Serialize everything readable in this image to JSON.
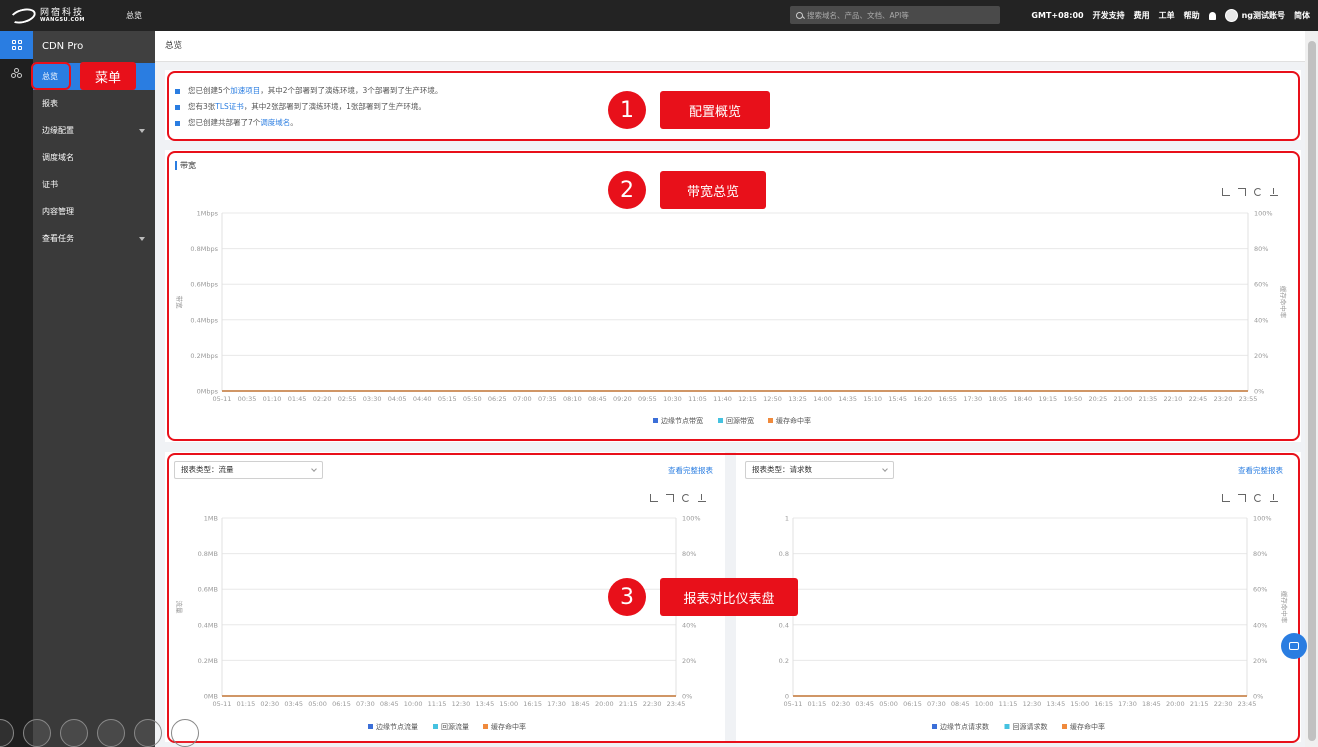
{
  "topbar": {
    "logo_cn": "网宿科技",
    "logo_en": "WANGSU.COM",
    "title": "总览",
    "search_placeholder": "搜索域名、产品、文档、API等",
    "timezone": "GMT+08:00",
    "links": [
      "开发支持",
      "费用",
      "工单",
      "帮助"
    ],
    "account": "ng测试账号",
    "lang": "简体"
  },
  "sidebar": {
    "product": "CDN Pro",
    "items": [
      {
        "label": "总览",
        "active": true,
        "caret": false
      },
      {
        "label": "报表",
        "active": false,
        "caret": false
      },
      {
        "label": "边缘配置",
        "active": false,
        "caret": true
      },
      {
        "label": "调度域名",
        "active": false,
        "caret": false
      },
      {
        "label": "证书",
        "active": false,
        "caret": false
      },
      {
        "label": "内容管理",
        "active": false,
        "caret": false
      },
      {
        "label": "查看任务",
        "active": false,
        "caret": true
      }
    ]
  },
  "main": {
    "breadcrumb": "总览",
    "overview": {
      "line1_pre": "您已创建5个",
      "line1_link": "加速项目",
      "line1_post": "，其中2个部署到了演练环境，3个部署到了生产环境。",
      "line2_pre": "您有3张",
      "line2_link": "TLS证书",
      "line2_post": "，其中2张部署到了演练环境，1张部署到了生产环境。",
      "line3_pre": "您已创建共部署了7个",
      "line3_link": "调度域名",
      "line3_post": "。"
    },
    "bandwidth_title": "带宽",
    "report_left": {
      "type_label": "报表类型：",
      "type_value": "流量",
      "full_link": "查看完整报表"
    },
    "report_right": {
      "type_label": "报表类型：",
      "type_value": "请求数",
      "full_link": "查看完整报表"
    }
  },
  "annotations": {
    "menu": "菜单",
    "n1": "1",
    "l1": "配置概览",
    "n2": "2",
    "l2": "带宽总览",
    "n3": "3",
    "l3": "报表对比仪表盘"
  },
  "colors": {
    "red": "#e8101a",
    "blue": "#2a7de1",
    "edge": "#3b6fd8",
    "origin": "#45c2e0",
    "cache": "#f08a3c"
  },
  "chart_data": [
    {
      "type": "line",
      "title": "带宽",
      "ylabel": "带宽",
      "y2label": "缓存命中率",
      "yticks": [
        "0Mbps",
        "0.2Mbps",
        "0.4Mbps",
        "0.6Mbps",
        "0.8Mbps",
        "1Mbps"
      ],
      "y2ticks": [
        "0%",
        "20%",
        "40%",
        "60%",
        "80%",
        "100%"
      ],
      "ylim": [
        0,
        1
      ],
      "x": [
        "05-11",
        "00:35",
        "01:10",
        "01:45",
        "02:20",
        "02:55",
        "03:30",
        "04:05",
        "04:40",
        "05:15",
        "05:50",
        "06:25",
        "07:00",
        "07:35",
        "08:10",
        "08:45",
        "09:20",
        "09:55",
        "10:30",
        "11:05",
        "11:40",
        "12:15",
        "12:50",
        "13:25",
        "14:00",
        "14:35",
        "15:10",
        "15:45",
        "16:20",
        "16:55",
        "17:30",
        "18:05",
        "18:40",
        "19:15",
        "19:50",
        "20:25",
        "21:00",
        "21:35",
        "22:10",
        "22:45",
        "23:20",
        "23:55"
      ],
      "series": [
        {
          "name": "边缘节点带宽",
          "values": [
            0
          ]
        },
        {
          "name": "回源带宽",
          "values": [
            0
          ]
        },
        {
          "name": "缓存命中率",
          "values": [
            0
          ]
        }
      ]
    },
    {
      "type": "line",
      "ylabel": "流量",
      "y2label": "命",
      "yticks": [
        "0MB",
        "0.2MB",
        "0.4MB",
        "0.6MB",
        "0.8MB",
        "1MB"
      ],
      "y2ticks": [
        "0%",
        "20%",
        "40%",
        "60%",
        "80%",
        "100%"
      ],
      "ylim": [
        0,
        1
      ],
      "x": [
        "05-11",
        "01:15",
        "02:30",
        "03:45",
        "05:00",
        "06:15",
        "07:30",
        "08:45",
        "10:00",
        "11:15",
        "12:30",
        "13:45",
        "15:00",
        "16:15",
        "17:30",
        "18:45",
        "20:00",
        "21:15",
        "22:30",
        "23:45"
      ],
      "series": [
        {
          "name": "边缘节点流量",
          "values": [
            0
          ]
        },
        {
          "name": "回源流量",
          "values": [
            0
          ]
        },
        {
          "name": "缓存命中率",
          "values": [
            0
          ]
        }
      ]
    },
    {
      "type": "line",
      "ylabel": "请",
      "y2label": "缓存命中率",
      "yticks": [
        "0",
        "0.2",
        "0.4",
        "0.6",
        "0.8",
        "1"
      ],
      "y2ticks": [
        "0%",
        "20%",
        "40%",
        "60%",
        "80%",
        "100%"
      ],
      "ylim": [
        0,
        1
      ],
      "x": [
        "05-11",
        "01:15",
        "02:30",
        "03:45",
        "05:00",
        "06:15",
        "07:30",
        "08:45",
        "10:00",
        "11:15",
        "12:30",
        "13:45",
        "15:00",
        "16:15",
        "17:30",
        "18:45",
        "20:00",
        "21:15",
        "22:30",
        "23:45"
      ],
      "series": [
        {
          "name": "边缘节点请求数",
          "values": [
            0
          ]
        },
        {
          "name": "回源请求数",
          "values": [
            0
          ]
        },
        {
          "name": "缓存命中率",
          "values": [
            0
          ]
        }
      ]
    }
  ]
}
